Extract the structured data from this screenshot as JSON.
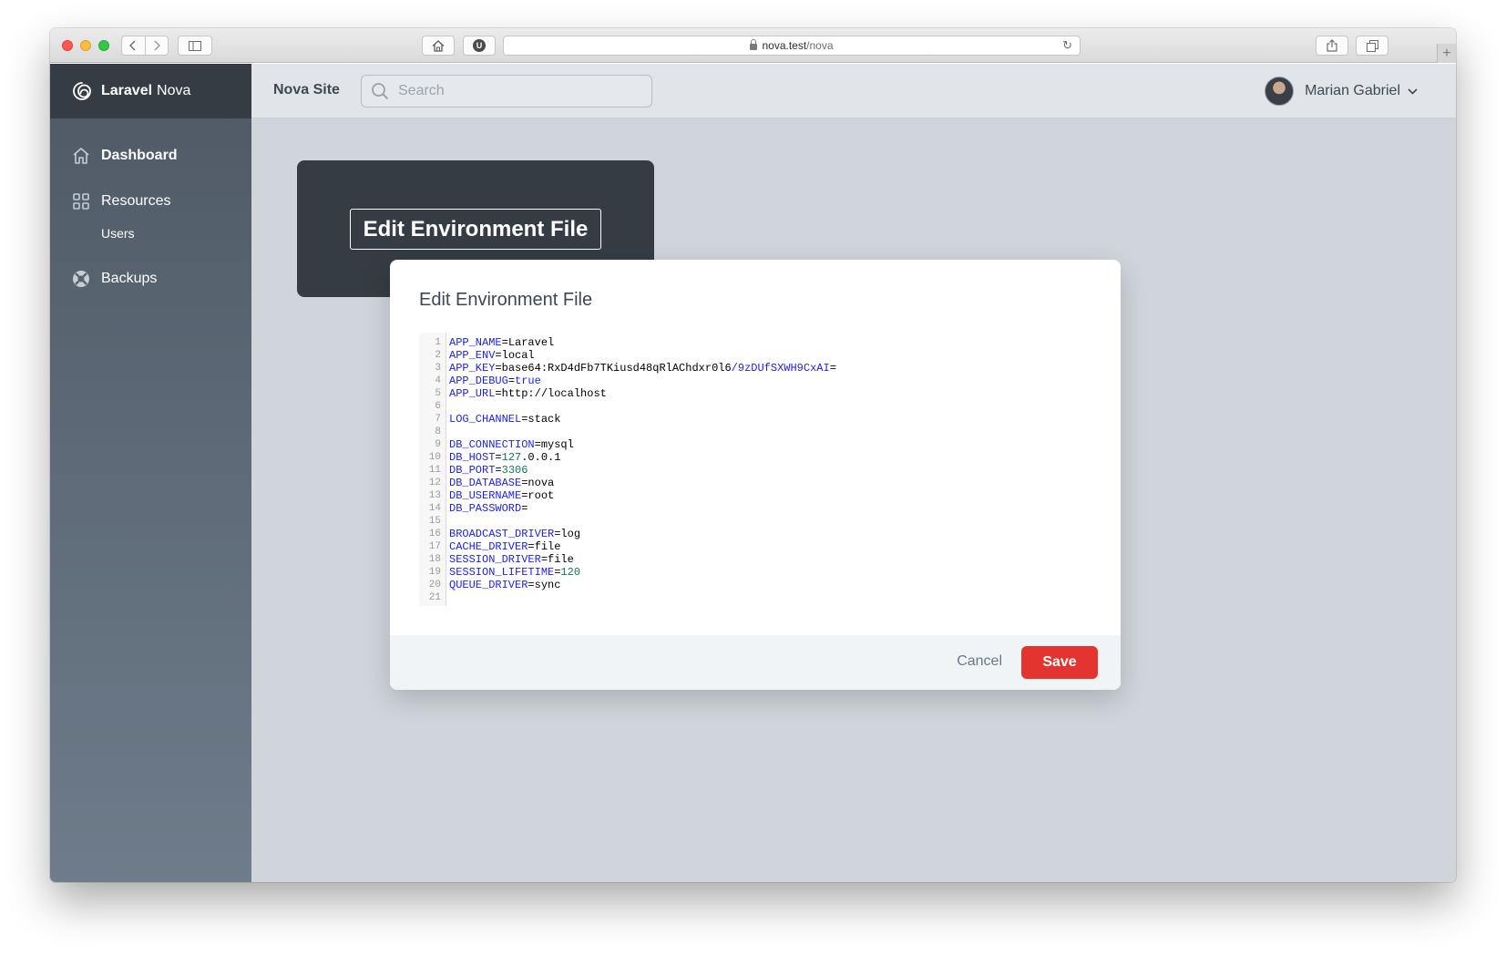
{
  "browser": {
    "url_host": "nova.test",
    "url_path": "/nova"
  },
  "app": {
    "brand_bold": "Laravel",
    "brand_light": "Nova",
    "site_name": "Nova Site",
    "search_placeholder": "Search",
    "user_name": "Marian Gabriel"
  },
  "sidebar": {
    "dashboard": "Dashboard",
    "resources": "Resources",
    "users": "Users",
    "backups": "Backups"
  },
  "tool": {
    "button_label": "Edit Environment File"
  },
  "modal": {
    "title": "Edit Environment File",
    "cancel_label": "Cancel",
    "save_label": "Save",
    "lines": [
      {
        "key": "APP_NAME",
        "value": "Laravel",
        "type": "str"
      },
      {
        "key": "APP_ENV",
        "value": "local",
        "type": "str"
      },
      {
        "key": "APP_KEY",
        "value": "base64:RxD4dFb7TKiusd48qRlAChdxr0l6/9zDUfSXWH9CxAI=",
        "type": "key"
      },
      {
        "key": "APP_DEBUG",
        "value": "true",
        "type": "kw"
      },
      {
        "key": "APP_URL",
        "value": "http://localhost",
        "type": "str"
      },
      {
        "key": "",
        "value": "",
        "type": "empty"
      },
      {
        "key": "LOG_CHANNEL",
        "value": "stack",
        "type": "str"
      },
      {
        "key": "",
        "value": "",
        "type": "empty"
      },
      {
        "key": "DB_CONNECTION",
        "value": "mysql",
        "type": "str"
      },
      {
        "key": "DB_HOST",
        "value": "127.0.0.1",
        "type": "ip"
      },
      {
        "key": "DB_PORT",
        "value": "3306",
        "type": "num"
      },
      {
        "key": "DB_DATABASE",
        "value": "nova",
        "type": "str"
      },
      {
        "key": "DB_USERNAME",
        "value": "root",
        "type": "str"
      },
      {
        "key": "DB_PASSWORD",
        "value": "",
        "type": "str"
      },
      {
        "key": "",
        "value": "",
        "type": "empty"
      },
      {
        "key": "BROADCAST_DRIVER",
        "value": "log",
        "type": "str"
      },
      {
        "key": "CACHE_DRIVER",
        "value": "file",
        "type": "str"
      },
      {
        "key": "SESSION_DRIVER",
        "value": "file",
        "type": "str"
      },
      {
        "key": "SESSION_LIFETIME",
        "value": "120",
        "type": "num"
      },
      {
        "key": "QUEUE_DRIVER",
        "value": "sync",
        "type": "str"
      },
      {
        "key": "",
        "value": "",
        "type": "empty"
      }
    ]
  },
  "colors": {
    "sidebar_top": "#4f5965",
    "brand_bg": "#363c44",
    "save_red": "#e3342f",
    "code_key_blue": "#2020ee",
    "code_num_green": "#117755"
  }
}
